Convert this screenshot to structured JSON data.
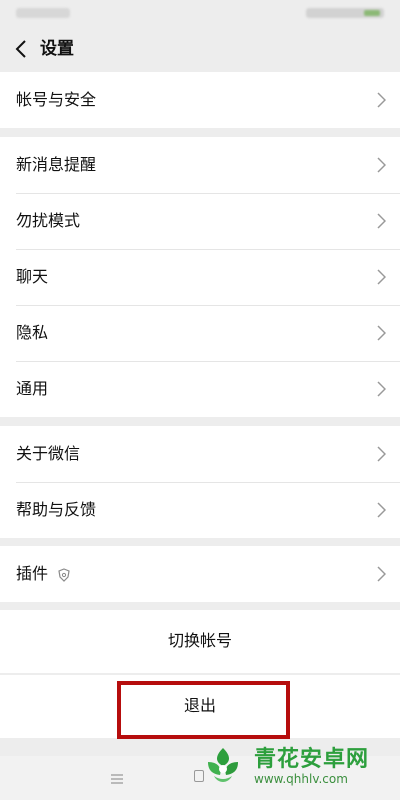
{
  "header": {
    "title": "设置"
  },
  "groups": [
    {
      "items": [
        {
          "label": "帐号与安全"
        }
      ]
    },
    {
      "items": [
        {
          "label": "新消息提醒"
        },
        {
          "label": "勿扰模式"
        },
        {
          "label": "聊天"
        },
        {
          "label": "隐私"
        },
        {
          "label": "通用"
        }
      ]
    },
    {
      "items": [
        {
          "label": "关于微信"
        },
        {
          "label": "帮助与反馈"
        }
      ]
    },
    {
      "items": [
        {
          "label": "插件"
        }
      ]
    }
  ],
  "actions": {
    "switch_account": "切换帐号",
    "logout": "退出"
  },
  "watermark": {
    "text": "青花安卓网",
    "url": "www.qhhlv.com"
  },
  "colors": {
    "background": "#ededed",
    "highlight_box": "#b60d0d",
    "watermark_green": "#2d9f3d"
  }
}
